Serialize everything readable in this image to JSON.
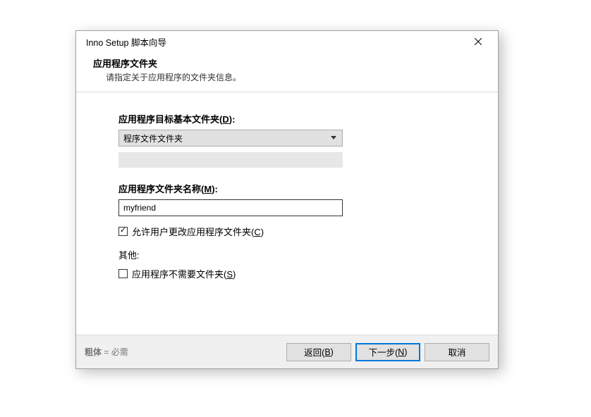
{
  "titlebar": {
    "title": "Inno Setup 脚本向导"
  },
  "header": {
    "title": "应用程序文件夹",
    "subtitle": "请指定关于应用程序的文件夹信息。"
  },
  "dest": {
    "label_prefix": "应用程序目标基本文件夹(",
    "label_accel": "D",
    "label_suffix": "):",
    "combo_value": "程序文件文件夹",
    "sub_value": ""
  },
  "name": {
    "label_prefix": "应用程序文件夹名称(",
    "label_accel": "M",
    "label_suffix": "):",
    "value": "myfriend"
  },
  "allow_change": {
    "label_prefix": "允许用户更改应用程序文件夹(",
    "label_accel": "C",
    "label_suffix": ")"
  },
  "other_label": "其他:",
  "no_folder": {
    "label_prefix": "应用程序不需要文件夹(",
    "label_accel": "S",
    "label_suffix": ")"
  },
  "footer": {
    "note_bold": "粗体",
    "note_eq": " = 必需",
    "back_prefix": "返回(",
    "back_accel": "B",
    "back_suffix": ")",
    "next_prefix": "下一步(",
    "next_accel": "N",
    "next_suffix": ")",
    "cancel": "取消"
  }
}
